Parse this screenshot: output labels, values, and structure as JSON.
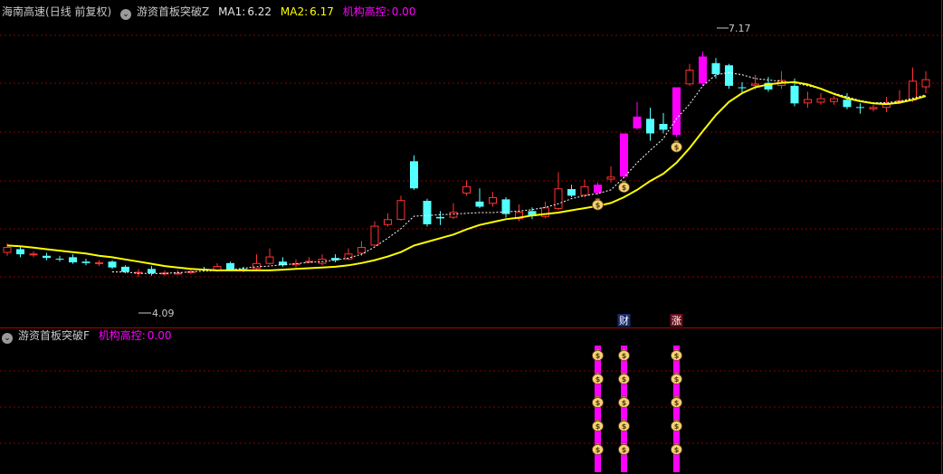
{
  "header_main": {
    "stock_name": "海南高速",
    "period": "(日线 前复权)",
    "indicator_name": "游资首板突破Z",
    "ma1_label": "MA1:",
    "ma1_value": "6.22",
    "ma2_label": "MA2:",
    "ma2_value": "6.17",
    "jigou_label": "机构高控:",
    "jigou_value": "0.00"
  },
  "header_sub": {
    "indicator_name": "游资首板突破F",
    "jigou_label": "机构高控:",
    "jigou_value": "0.00"
  },
  "markers": {
    "cai": "财",
    "zhang": "涨"
  },
  "colors": {
    "up": "#ff3232",
    "down": "#54ffff",
    "strong_up": "#ff00ff",
    "ma_solid": "#ffff00",
    "ma_dash": "#ffffff",
    "grid": "#8b0000",
    "text": "#c8c8c8",
    "magenta_text": "#ff00ff"
  },
  "chart_data": {
    "type": "candlestick",
    "price_axis": {
      "min": 3.5,
      "max": 7.6
    },
    "high_label": "7.17",
    "low_label": "4.09",
    "candles": [
      {
        "o": 4.5,
        "c": 4.42,
        "h": 4.55,
        "l": 4.38,
        "k": "up"
      },
      {
        "o": 4.47,
        "c": 4.4,
        "h": 4.5,
        "l": 4.36,
        "k": "down"
      },
      {
        "o": 4.41,
        "c": 4.4,
        "h": 4.44,
        "l": 4.36,
        "k": "up"
      },
      {
        "o": 4.38,
        "c": 4.35,
        "h": 4.42,
        "l": 4.32,
        "k": "down"
      },
      {
        "o": 4.34,
        "c": 4.33,
        "h": 4.38,
        "l": 4.3,
        "k": "down"
      },
      {
        "o": 4.36,
        "c": 4.29,
        "h": 4.4,
        "l": 4.27,
        "k": "down"
      },
      {
        "o": 4.3,
        "c": 4.28,
        "h": 4.34,
        "l": 4.25,
        "k": "down"
      },
      {
        "o": 4.27,
        "c": 4.29,
        "h": 4.32,
        "l": 4.24,
        "k": "up"
      },
      {
        "o": 4.3,
        "c": 4.22,
        "h": 4.32,
        "l": 4.2,
        "k": "down"
      },
      {
        "o": 4.23,
        "c": 4.16,
        "h": 4.25,
        "l": 4.14,
        "k": "down"
      },
      {
        "o": 4.16,
        "c": 4.15,
        "h": 4.2,
        "l": 4.09,
        "k": "up"
      },
      {
        "o": 4.2,
        "c": 4.14,
        "h": 4.24,
        "l": 4.11,
        "k": "down"
      },
      {
        "o": 4.13,
        "c": 4.15,
        "h": 4.18,
        "l": 4.11,
        "k": "up"
      },
      {
        "o": 4.15,
        "c": 4.14,
        "h": 4.18,
        "l": 4.12,
        "k": "up"
      },
      {
        "o": 4.15,
        "c": 4.17,
        "h": 4.2,
        "l": 4.13,
        "k": "up"
      },
      {
        "o": 4.2,
        "c": 4.19,
        "h": 4.23,
        "l": 4.17,
        "k": "down"
      },
      {
        "o": 4.17,
        "c": 4.24,
        "h": 4.28,
        "l": 4.16,
        "k": "up"
      },
      {
        "o": 4.28,
        "c": 4.19,
        "h": 4.3,
        "l": 4.17,
        "k": "down"
      },
      {
        "o": 4.2,
        "c": 4.18,
        "h": 4.23,
        "l": 4.16,
        "k": "down"
      },
      {
        "o": 4.2,
        "c": 4.28,
        "h": 4.4,
        "l": 4.19,
        "k": "up"
      },
      {
        "o": 4.27,
        "c": 4.37,
        "h": 4.48,
        "l": 4.26,
        "k": "up"
      },
      {
        "o": 4.3,
        "c": 4.25,
        "h": 4.36,
        "l": 4.23,
        "k": "down"
      },
      {
        "o": 4.25,
        "c": 4.28,
        "h": 4.33,
        "l": 4.22,
        "k": "up"
      },
      {
        "o": 4.3,
        "c": 4.31,
        "h": 4.36,
        "l": 4.28,
        "k": "up"
      },
      {
        "o": 4.27,
        "c": 4.34,
        "h": 4.4,
        "l": 4.25,
        "k": "up"
      },
      {
        "o": 4.35,
        "c": 4.32,
        "h": 4.4,
        "l": 4.29,
        "k": "down"
      },
      {
        "o": 4.33,
        "c": 4.41,
        "h": 4.48,
        "l": 4.32,
        "k": "up"
      },
      {
        "o": 4.41,
        "c": 4.5,
        "h": 4.58,
        "l": 4.38,
        "k": "up"
      },
      {
        "o": 4.52,
        "c": 4.79,
        "h": 4.85,
        "l": 4.5,
        "k": "up"
      },
      {
        "o": 4.8,
        "c": 4.88,
        "h": 4.96,
        "l": 4.78,
        "k": "up"
      },
      {
        "o": 4.87,
        "c": 5.14,
        "h": 5.2,
        "l": 4.86,
        "k": "up"
      },
      {
        "o": 5.3,
        "c": 5.67,
        "h": 5.75,
        "l": 5.28,
        "k": "down"
      },
      {
        "o": 5.13,
        "c": 4.81,
        "h": 5.16,
        "l": 4.78,
        "k": "down"
      },
      {
        "o": 4.91,
        "c": 4.89,
        "h": 4.99,
        "l": 4.8,
        "k": "down"
      },
      {
        "o": 4.9,
        "c": 4.98,
        "h": 5.1,
        "l": 4.88,
        "k": "up"
      },
      {
        "o": 5.23,
        "c": 5.33,
        "h": 5.41,
        "l": 5.2,
        "k": "up"
      },
      {
        "o": 5.12,
        "c": 5.05,
        "h": 5.3,
        "l": 5.03,
        "k": "down"
      },
      {
        "o": 5.09,
        "c": 5.18,
        "h": 5.25,
        "l": 5.05,
        "k": "up"
      },
      {
        "o": 5.15,
        "c": 4.95,
        "h": 5.18,
        "l": 4.9,
        "k": "down"
      },
      {
        "o": 4.88,
        "c": 4.98,
        "h": 5.08,
        "l": 4.85,
        "k": "up"
      },
      {
        "o": 4.92,
        "c": 4.99,
        "h": 5.04,
        "l": 4.88,
        "k": "down"
      },
      {
        "o": 4.91,
        "c": 5.04,
        "h": 5.12,
        "l": 4.89,
        "k": "up"
      },
      {
        "o": 5.02,
        "c": 5.3,
        "h": 5.52,
        "l": 5.0,
        "k": "up"
      },
      {
        "o": 5.29,
        "c": 5.2,
        "h": 5.35,
        "l": 5.18,
        "k": "down"
      },
      {
        "o": 5.2,
        "c": 5.33,
        "h": 5.42,
        "l": 5.18,
        "k": "up"
      },
      {
        "o": 5.24,
        "c": 5.35,
        "h": 5.38,
        "l": 5.21,
        "k": "pink"
      },
      {
        "o": 5.42,
        "c": 5.46,
        "h": 5.6,
        "l": 5.38,
        "k": "up"
      },
      {
        "o": 5.46,
        "c": 6.05,
        "h": 6.05,
        "l": 5.45,
        "k": "pink"
      },
      {
        "o": 6.12,
        "c": 6.28,
        "h": 6.48,
        "l": 6.1,
        "k": "pink"
      },
      {
        "o": 6.25,
        "c": 6.05,
        "h": 6.4,
        "l": 5.95,
        "k": "down"
      },
      {
        "o": 6.1,
        "c": 6.18,
        "h": 6.33,
        "l": 6.05,
        "k": "down"
      },
      {
        "o": 6.03,
        "c": 6.68,
        "h": 6.68,
        "l": 6.0,
        "k": "pink"
      },
      {
        "o": 6.72,
        "c": 6.92,
        "h": 7.0,
        "l": 6.7,
        "k": "up"
      },
      {
        "o": 6.73,
        "c": 7.1,
        "h": 7.17,
        "l": 6.7,
        "k": "pink"
      },
      {
        "o": 7.01,
        "c": 6.86,
        "h": 7.08,
        "l": 6.8,
        "k": "down"
      },
      {
        "o": 6.98,
        "c": 6.7,
        "h": 7.0,
        "l": 6.66,
        "k": "down"
      },
      {
        "o": 6.68,
        "c": 6.68,
        "h": 6.75,
        "l": 6.6,
        "k": "down"
      },
      {
        "o": 6.7,
        "c": 6.73,
        "h": 6.85,
        "l": 6.65,
        "k": "up"
      },
      {
        "o": 6.74,
        "c": 6.65,
        "h": 6.82,
        "l": 6.62,
        "k": "down"
      },
      {
        "o": 6.7,
        "c": 6.78,
        "h": 6.9,
        "l": 6.66,
        "k": "up"
      },
      {
        "o": 6.7,
        "c": 6.46,
        "h": 6.8,
        "l": 6.42,
        "k": "down"
      },
      {
        "o": 6.46,
        "c": 6.52,
        "h": 6.62,
        "l": 6.4,
        "k": "up"
      },
      {
        "o": 6.47,
        "c": 6.53,
        "h": 6.6,
        "l": 6.44,
        "k": "up"
      },
      {
        "o": 6.48,
        "c": 6.53,
        "h": 6.56,
        "l": 6.44,
        "k": "up"
      },
      {
        "o": 6.51,
        "c": 6.41,
        "h": 6.6,
        "l": 6.38,
        "k": "down"
      },
      {
        "o": 6.4,
        "c": 6.41,
        "h": 6.46,
        "l": 6.32,
        "k": "down"
      },
      {
        "o": 6.38,
        "c": 6.41,
        "h": 6.44,
        "l": 6.35,
        "k": "up"
      },
      {
        "o": 6.4,
        "c": 6.46,
        "h": 6.55,
        "l": 6.34,
        "k": "up"
      },
      {
        "o": 6.48,
        "c": 6.5,
        "h": 6.64,
        "l": 6.45,
        "k": "up"
      },
      {
        "o": 6.5,
        "c": 6.77,
        "h": 6.95,
        "l": 6.48,
        "k": "up"
      },
      {
        "o": 6.68,
        "c": 6.79,
        "h": 6.9,
        "l": 6.6,
        "k": "up"
      }
    ],
    "ma_solid": [
      4.52,
      4.51,
      4.49,
      4.47,
      4.45,
      4.43,
      4.41,
      4.38,
      4.36,
      4.33,
      4.3,
      4.27,
      4.24,
      4.22,
      4.2,
      4.19,
      4.18,
      4.18,
      4.18,
      4.18,
      4.18,
      4.19,
      4.2,
      4.21,
      4.22,
      4.23,
      4.25,
      4.28,
      4.32,
      4.37,
      4.43,
      4.52,
      4.57,
      4.62,
      4.67,
      4.74,
      4.8,
      4.84,
      4.88,
      4.9,
      4.93,
      4.95,
      4.97,
      5.0,
      5.03,
      5.06,
      5.1,
      5.18,
      5.28,
      5.4,
      5.5,
      5.65,
      5.85,
      6.08,
      6.3,
      6.48,
      6.6,
      6.68,
      6.72,
      6.74,
      6.75,
      6.72,
      6.66,
      6.59,
      6.53,
      6.49,
      6.46,
      6.45,
      6.47,
      6.51,
      6.56
    ],
    "ma_dash": [
      null,
      null,
      null,
      null,
      null,
      null,
      null,
      null,
      4.16,
      4.16,
      4.14,
      4.14,
      4.14,
      4.15,
      4.16,
      4.17,
      4.18,
      4.19,
      4.21,
      4.23,
      4.24,
      4.26,
      4.27,
      4.29,
      4.3,
      4.32,
      4.35,
      4.4,
      4.5,
      4.62,
      4.75,
      4.92,
      4.93,
      4.94,
      4.95,
      4.96,
      4.97,
      4.97,
      4.98,
      4.99,
      5.01,
      5.04,
      5.09,
      5.16,
      5.2,
      5.23,
      5.28,
      5.45,
      5.65,
      5.82,
      5.98,
      6.25,
      6.45,
      6.7,
      6.85,
      6.88,
      6.85,
      6.8,
      6.78,
      6.76,
      6.74,
      6.7,
      6.66,
      6.6,
      6.55,
      6.5,
      6.47,
      6.47,
      6.49,
      6.53,
      6.58
    ],
    "signals": [
      {
        "index": 45,
        "marker": ""
      },
      {
        "index": 47,
        "marker": "cai"
      },
      {
        "index": 51,
        "marker": "zhang"
      }
    ],
    "sub_panel_icon_rows": 5
  }
}
